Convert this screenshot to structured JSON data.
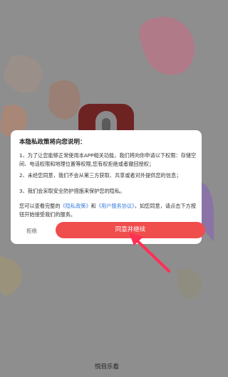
{
  "dialog": {
    "title": "本隐私政策将向您说明：",
    "para1": "1、为了让您能够正常使用本APP相关功能，我们将向你申请以下权限：存储空间、电话权限和地理位置等权限,您有权拒绝或者撤回授权；",
    "para2": "2、未经您同意，我们不会从第三方获取、共享或者对外提供您的信息；",
    "para3": "3、我们会采取安全防护措施来保护您的隐私。",
    "para4_prefix": "您可以查看完整的",
    "privacy_link": "《隐私政策》",
    "para4_and": "和",
    "terms_link": "《用户服务协议》",
    "para4_suffix": "，如您同意，请点击下方按钮开始接受我们的服务。",
    "reject_label": "拒绝",
    "agree_label": "同意并继续"
  },
  "app_name": "悦目乐看",
  "colors": {
    "accent": "#f04d4d",
    "link": "#3b7fdb",
    "overlay": "#8e8e8e"
  }
}
